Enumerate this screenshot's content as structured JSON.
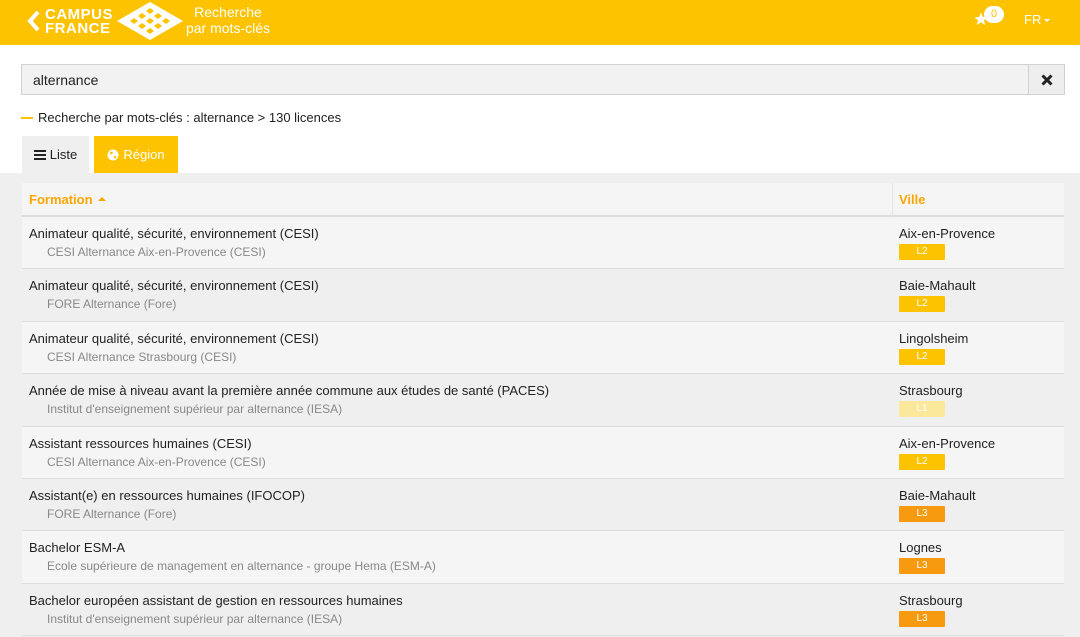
{
  "header": {
    "logo_line1": "CAMPUS",
    "logo_line2": "FRANCE",
    "subtitle_line1": "Recherche",
    "subtitle_line2": "par mots-clés",
    "favorites_count": "0",
    "language": "FR",
    "background_color": "#fdc300"
  },
  "search": {
    "value": "alternance",
    "placeholder": ""
  },
  "breadcrumb": {
    "text": "Recherche par mots-clés : alternance > 130 licences"
  },
  "tabs": [
    {
      "label": "Liste",
      "icon": "list-icon",
      "active": false
    },
    {
      "label": "Région",
      "icon": "globe-icon",
      "active": true
    }
  ],
  "table": {
    "columns": [
      "Formation",
      "Ville"
    ],
    "header_color": "#fba600",
    "rows": [
      {
        "title": "Animateur qualité, sécurité, environnement (CESI)",
        "institution": "CESI Alternance Aix-en-Provence (CESI)",
        "city": "Aix-en-Provence",
        "level": "L2",
        "level_color": "#fdc300"
      },
      {
        "title": "Animateur qualité, sécurité, environnement (CESI)",
        "institution": "FORE Alternance (Fore)",
        "city": "Baie-Mahault",
        "level": "L2",
        "level_color": "#fdc300"
      },
      {
        "title": "Animateur qualité, sécurité, environnement (CESI)",
        "institution": "CESI Alternance Strasbourg (CESI)",
        "city": "Lingolsheim",
        "level": "L2",
        "level_color": "#fdc300"
      },
      {
        "title": "Année de mise à niveau avant la première année commune aux études de santé (PACES)",
        "institution": "Institut d'enseignement supérieur par alternance (IESA)",
        "city": "Strasbourg",
        "level": "L1",
        "level_color": "#fbe89a"
      },
      {
        "title": "Assistant ressources humaines (CESI)",
        "institution": "CESI Alternance Aix-en-Provence (CESI)",
        "city": "Aix-en-Provence",
        "level": "L2",
        "level_color": "#fdc300"
      },
      {
        "title": "Assistant(e) en ressources humaines (IFOCOP)",
        "institution": "FORE Alternance (Fore)",
        "city": "Baie-Mahault",
        "level": "L3",
        "level_color": "#f79a0f"
      },
      {
        "title": "Bachelor ESM-A",
        "institution": "Ecole supérieure de management en alternance - groupe Hema (ESM-A)",
        "city": "Lognes",
        "level": "L3",
        "level_color": "#f79a0f"
      },
      {
        "title": "Bachelor européen assistant de gestion en ressources humaines",
        "institution": "Institut d'enseignement supérieur par alternance (IESA)",
        "city": "Strasbourg",
        "level": "L3",
        "level_color": "#f79a0f"
      }
    ]
  }
}
